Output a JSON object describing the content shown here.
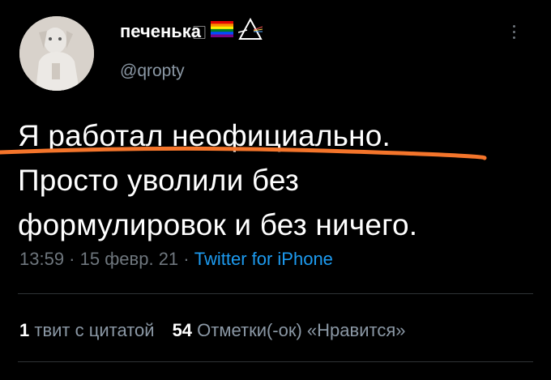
{
  "author": {
    "display_name": "печенька",
    "name_glyph": "⃞",
    "handle": "@qropty"
  },
  "tweet": {
    "lines": [
      "Я работал неофициально.",
      "Просто уволили без",
      "формулировок и без ничего."
    ],
    "time": "13:59",
    "date": "15 февр. 21",
    "separator": " · ",
    "source": "Twitter for iPhone"
  },
  "stats": {
    "quotes_count": "1",
    "quotes_label": "твит с цитатой",
    "likes_count": "54",
    "likes_label": "Отметки(-ок) «Нравится»"
  },
  "colors": {
    "background": "#000000",
    "text": "#ffffff",
    "secondary": "#6e767d",
    "link": "#1d9bf0",
    "highlight_line": "#f4752b"
  },
  "icons": {
    "flag": "rainbow-flag-icon",
    "prism": "prism-icon",
    "more": "more-vertical-icon"
  }
}
